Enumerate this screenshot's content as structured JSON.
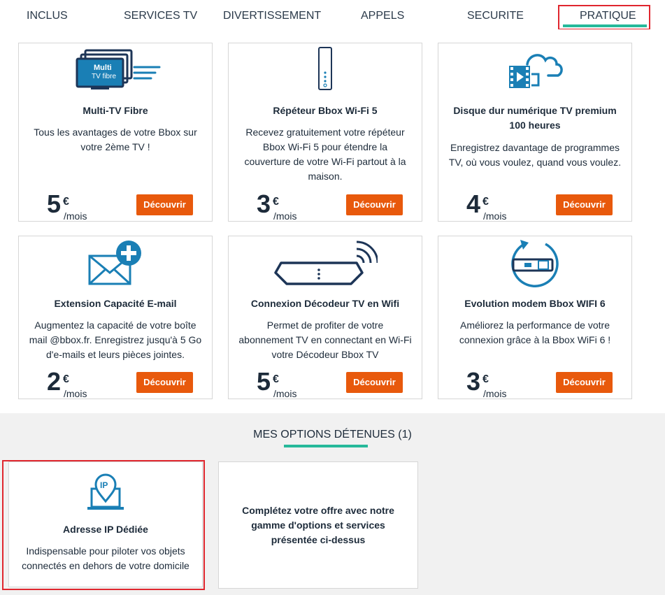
{
  "tabs": [
    {
      "label": "INCLUS"
    },
    {
      "label": "SERVICES TV"
    },
    {
      "label": "DIVERTISSEMENT"
    },
    {
      "label": "APPELS"
    },
    {
      "label": "SECURITE"
    },
    {
      "label": "PRATIQUE",
      "active": true
    }
  ],
  "options": [
    {
      "icon": "multi-tv-fibre-icon",
      "icon_text_1": "Multi",
      "icon_text_2": "TV fibre",
      "title": "Multi-TV Fibre",
      "description": "Tous les avantages de votre Bbox sur votre 2ème TV !",
      "price": "5",
      "currency": "€",
      "period": "/mois",
      "button": "Découvrir"
    },
    {
      "icon": "wifi-repeater-icon",
      "title": "Répéteur Bbox Wi-Fi 5",
      "description": "Recevez gratuitement votre répéteur Bbox Wi-Fi 5 pour étendre la couverture de votre Wi-Fi partout à la maison.",
      "price": "3",
      "currency": "€",
      "period": "/mois",
      "button": "Découvrir"
    },
    {
      "icon": "cloud-video-icon",
      "title": "Disque dur numérique TV premium 100 heures",
      "description": "Enregistrez davantage de programmes TV, où vous voulez, quand vous voulez.",
      "price": "4",
      "currency": "€",
      "period": "/mois",
      "button": "Découvrir"
    },
    {
      "icon": "email-plus-icon",
      "title": "Extension Capacité E-mail",
      "description": "Augmentez la capacité de votre boîte mail @bbox.fr. Enregistrez jusqu'à 5 Go d'e-mails et leurs pièces jointes.",
      "price": "2",
      "currency": "€",
      "period": "/mois",
      "button": "Découvrir"
    },
    {
      "icon": "tv-decoder-wifi-icon",
      "title": "Connexion Décodeur TV en Wifi",
      "description": "Permet de profiter de votre abonnement TV en connectant en Wi-Fi votre Décodeur Bbox TV",
      "price": "5",
      "currency": "€",
      "period": "/mois",
      "button": "Découvrir"
    },
    {
      "icon": "modem-upgrade-icon",
      "title": "Evolution modem Bbox WIFI 6",
      "description": "Améliorez la performance de votre connexion grâce à la Bbox WiFi 6 !",
      "price": "3",
      "currency": "€",
      "period": "/mois",
      "button": "Découvrir"
    }
  ],
  "owned_section": {
    "title": "MES OPTIONS DÉTENUES (1)",
    "owned": {
      "icon": "ip-laptop-icon",
      "icon_text": "IP",
      "title": "Adresse IP Dédiée",
      "description": "Indispensable pour piloter vos objets connectés en dehors de votre domicile"
    },
    "promo": {
      "text": "Complétez votre offre avec notre gamme d'options et services présentée ci-dessus"
    }
  },
  "colors": {
    "accent": "#26b99a",
    "button": "#e8590c",
    "icon_blue": "#1a7fb5",
    "highlight_red": "#e0262e"
  }
}
